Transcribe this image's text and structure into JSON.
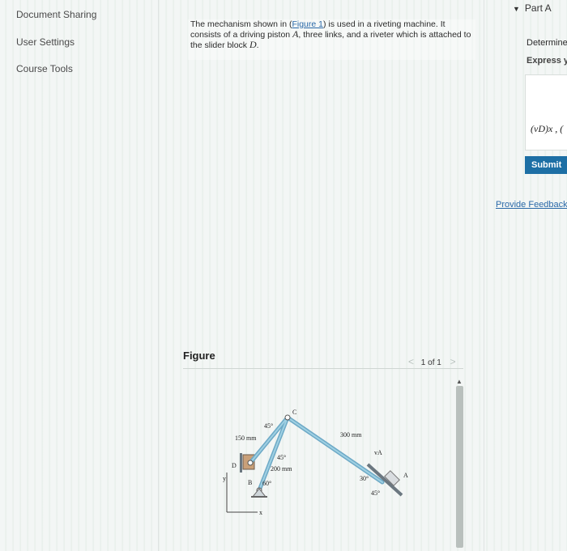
{
  "nav": {
    "items": [
      {
        "label": "Document Sharing"
      },
      {
        "label": "User Settings"
      },
      {
        "label": "Course Tools"
      }
    ]
  },
  "problem": {
    "text_1": "The mechanism shown in (",
    "figure_link": "Figure 1",
    "text_2": ") is used in a riveting machine. It consists of a driving piston ",
    "piston_var": "A",
    "text_3": ", three links, and a riveter which is attached to the slider block ",
    "block_var": "D",
    "text_4": "."
  },
  "figure": {
    "label": "Figure",
    "pager": "1 of 1",
    "prev_arrow": "<",
    "next_arrow": ">",
    "diagram_labels": {
      "angle_top": "45°",
      "point_c": "C",
      "len_150": "150 mm",
      "len_300": "300 mm",
      "angle_mid": "45°",
      "len_200": "200 mm",
      "point_d": "D",
      "point_b": "B",
      "angle_60": "60°",
      "angle_30": "30°",
      "angle_45b": "45°",
      "point_a": "A",
      "v_a": "vA",
      "axis_y": "y",
      "axis_x": "x"
    }
  },
  "part": {
    "label": "Part A",
    "determine": "Determine",
    "express": "Express y",
    "answer_label": "(vD)x , (",
    "submit": "Submit",
    "feedback": "Provide Feedback"
  },
  "colors": {
    "submit_bg": "#1d6fa5",
    "link": "#2a69a8",
    "link_bar": "#8fb9cc"
  }
}
